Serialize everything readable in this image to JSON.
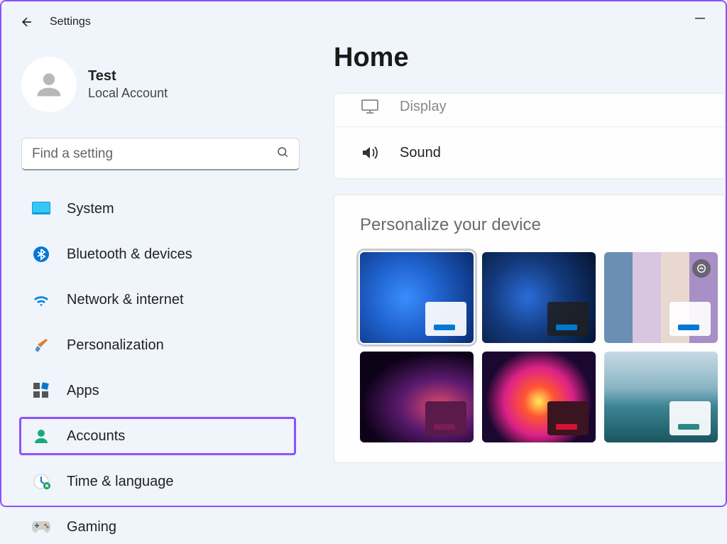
{
  "app": {
    "title": "Settings"
  },
  "user": {
    "name": "Test",
    "account_type": "Local Account"
  },
  "search": {
    "placeholder": "Find a setting"
  },
  "sidebar": {
    "items": [
      {
        "id": "system",
        "label": "System",
        "icon": "system-icon",
        "highlighted": false
      },
      {
        "id": "bluetooth",
        "label": "Bluetooth & devices",
        "icon": "bluetooth-icon",
        "highlighted": false
      },
      {
        "id": "network",
        "label": "Network & internet",
        "icon": "wifi-icon",
        "highlighted": false
      },
      {
        "id": "personalization",
        "label": "Personalization",
        "icon": "brush-icon",
        "highlighted": false
      },
      {
        "id": "apps",
        "label": "Apps",
        "icon": "apps-icon",
        "highlighted": false
      },
      {
        "id": "accounts",
        "label": "Accounts",
        "icon": "person-icon",
        "highlighted": true
      },
      {
        "id": "time",
        "label": "Time & language",
        "icon": "clock-icon",
        "highlighted": false
      },
      {
        "id": "gaming",
        "label": "Gaming",
        "icon": "gamepad-icon",
        "highlighted": false
      }
    ]
  },
  "main": {
    "title": "Home",
    "quick_settings": [
      {
        "id": "display",
        "label": "Display",
        "icon": "display-icon",
        "faded": true
      },
      {
        "id": "sound",
        "label": "Sound",
        "icon": "sound-icon",
        "faded": false
      }
    ],
    "personalize": {
      "heading": "Personalize your device",
      "themes": [
        {
          "id": "bloom-light",
          "accent": "#0078d4",
          "dark": false,
          "selected": true,
          "spotlight": false
        },
        {
          "id": "bloom-dark",
          "accent": "#0078d4",
          "dark": true,
          "selected": false,
          "spotlight": false
        },
        {
          "id": "spotlight",
          "accent": "#0078d4",
          "dark": false,
          "selected": false,
          "spotlight": true
        },
        {
          "id": "glow",
          "accent": "#7a1c5a",
          "dark": true,
          "selected": false,
          "spotlight": false
        },
        {
          "id": "flow",
          "accent": "#d81030",
          "dark": true,
          "selected": false,
          "spotlight": false
        },
        {
          "id": "lake",
          "accent": "#2a8a85",
          "dark": false,
          "selected": false,
          "spotlight": false
        }
      ]
    }
  },
  "colors": {
    "highlight": "#8c52ff",
    "accent": "#0078d4"
  }
}
